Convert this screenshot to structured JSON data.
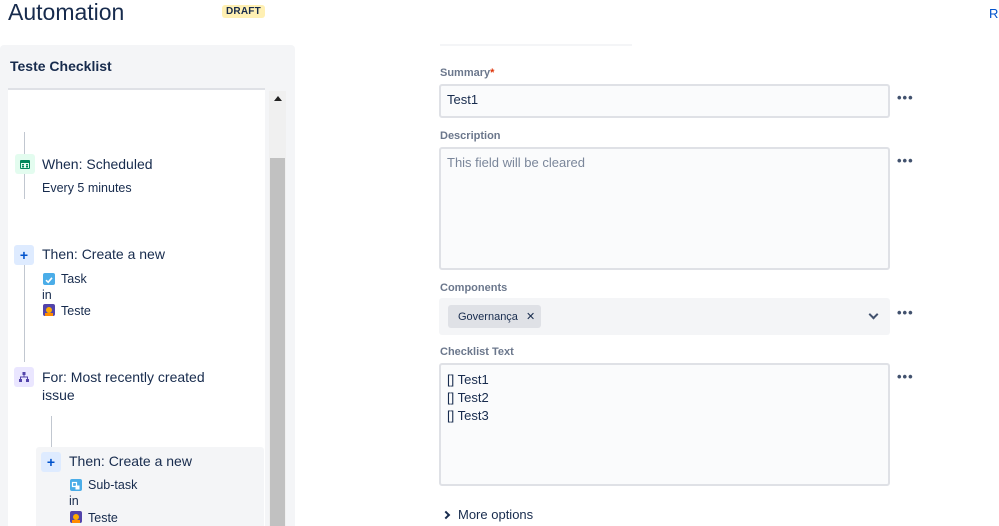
{
  "header": {
    "title": "Automation",
    "badge": "DRAFT",
    "top_right_link": "Re"
  },
  "rule": {
    "title": "Teste Checklist",
    "steps": [
      {
        "icon": "calendar-icon",
        "title": "When: Scheduled",
        "detail": "Every 5 minutes"
      },
      {
        "icon": "plus-icon",
        "title": "Then: Create a new",
        "issue_type": "Task",
        "connector": "in",
        "project": "Teste"
      },
      {
        "icon": "branch-icon",
        "title_line1": "For: Most recently created",
        "title_line2": "issue"
      },
      {
        "icon": "plus-icon",
        "title": "Then: Create a new",
        "issue_type": "Sub-task",
        "connector": "in",
        "project": "Teste"
      }
    ]
  },
  "form": {
    "summary": {
      "label": "Summary",
      "required_mark": "*",
      "value": "Test1"
    },
    "description": {
      "label": "Description",
      "placeholder": "This field will be cleared"
    },
    "components": {
      "label": "Components",
      "selected": [
        "Governança"
      ]
    },
    "checklist_text": {
      "label": "Checklist Text",
      "lines": [
        "[] Test1",
        "[] Test2",
        "[] Test3"
      ]
    },
    "more_options": "More options",
    "field_menu": "•••"
  },
  "colors": {
    "accent": "#0052cc",
    "badge_bg": "#fff0b3",
    "required": "#de350b",
    "panel_bg": "#f4f5f7"
  }
}
